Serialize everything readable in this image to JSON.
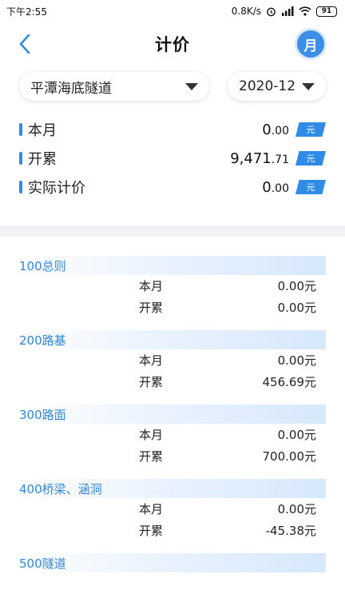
{
  "status_bar": {
    "time": "下午2:55",
    "network_speed": "0.8K/s",
    "battery": "91"
  },
  "header": {
    "title": "计价",
    "period_badge": "月"
  },
  "selectors": {
    "tunnel": "平潭海底隧道",
    "month": "2020-12"
  },
  "summary": [
    {
      "label": "本月",
      "value_int": "0",
      "value_dec": ".00",
      "unit": "元"
    },
    {
      "label": "开累",
      "value_int": "9,471",
      "value_dec": ".71",
      "unit": "元"
    },
    {
      "label": "实际计价",
      "value_int": "0",
      "value_dec": ".00",
      "unit": "元"
    }
  ],
  "sections": [
    {
      "title": "100总则",
      "rows": [
        {
          "label": "本月",
          "value": "0.00元"
        },
        {
          "label": "开累",
          "value": "0.00元"
        }
      ]
    },
    {
      "title": "200路基",
      "rows": [
        {
          "label": "本月",
          "value": "0.00元"
        },
        {
          "label": "开累",
          "value": "456.69元"
        }
      ]
    },
    {
      "title": "300路面",
      "rows": [
        {
          "label": "本月",
          "value": "0.00元"
        },
        {
          "label": "开累",
          "value": "700.00元"
        }
      ]
    },
    {
      "title": "400桥梁、涵洞",
      "rows": [
        {
          "label": "本月",
          "value": "0.00元"
        },
        {
          "label": "开累",
          "value": "-45.38元"
        }
      ]
    },
    {
      "title": "500隧道",
      "rows": []
    }
  ],
  "colors": {
    "accent": "#2f8be6",
    "section_title": "#2f86de",
    "divider": "#f1f2f6"
  }
}
